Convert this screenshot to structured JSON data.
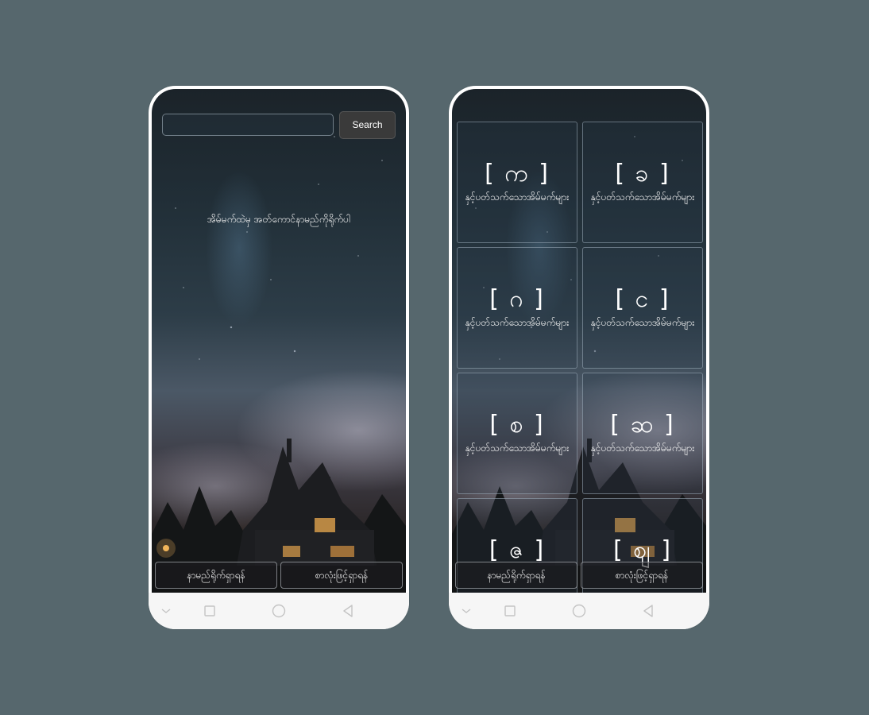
{
  "left_screen": {
    "search_button": "Search",
    "search_placeholder": "",
    "prompt": "အိမ်မက်ထဲမှ အတ်ကောင်နာမည်ကိုရိုက်ပါ",
    "bottom_left": "နာမည်ရိုက်ရှာရန်",
    "bottom_right": "စာလုံးဖြင့်ရှာရန်"
  },
  "right_screen": {
    "cards": [
      {
        "letter": "[ က ]",
        "desc": "နှင့်ပတ်သက်သောအိမ်မက်များ"
      },
      {
        "letter": "[ ခ ]",
        "desc": "နှင့်ပတ်သက်သောအိမ်မက်များ"
      },
      {
        "letter": "[ ဂ ]",
        "desc": "နှင့်ပတ်သက်သောအိမ်မက်များ"
      },
      {
        "letter": "[ င ]",
        "desc": "နှင့်ပတ်သက်သောအိမ်မက်များ"
      },
      {
        "letter": "[ စ ]",
        "desc": "နှင့်ပတ်သက်သောအိမ်မက်များ"
      },
      {
        "letter": "[ ဆ ]",
        "desc": "နှင့်ပတ်သက်သောအိမ်မက်များ"
      },
      {
        "letter": "[ ဇ ]",
        "desc": ""
      },
      {
        "letter": "[ စျ ]",
        "desc": ""
      }
    ],
    "bottom_left": "နာမည်ရိုက်ရှာရန်",
    "bottom_right": "စာလုံးဖြင့်ရှာရန်"
  },
  "nav_icons": [
    "chevron-down-icon",
    "square-recents-icon",
    "circle-home-icon",
    "triangle-back-icon"
  ]
}
